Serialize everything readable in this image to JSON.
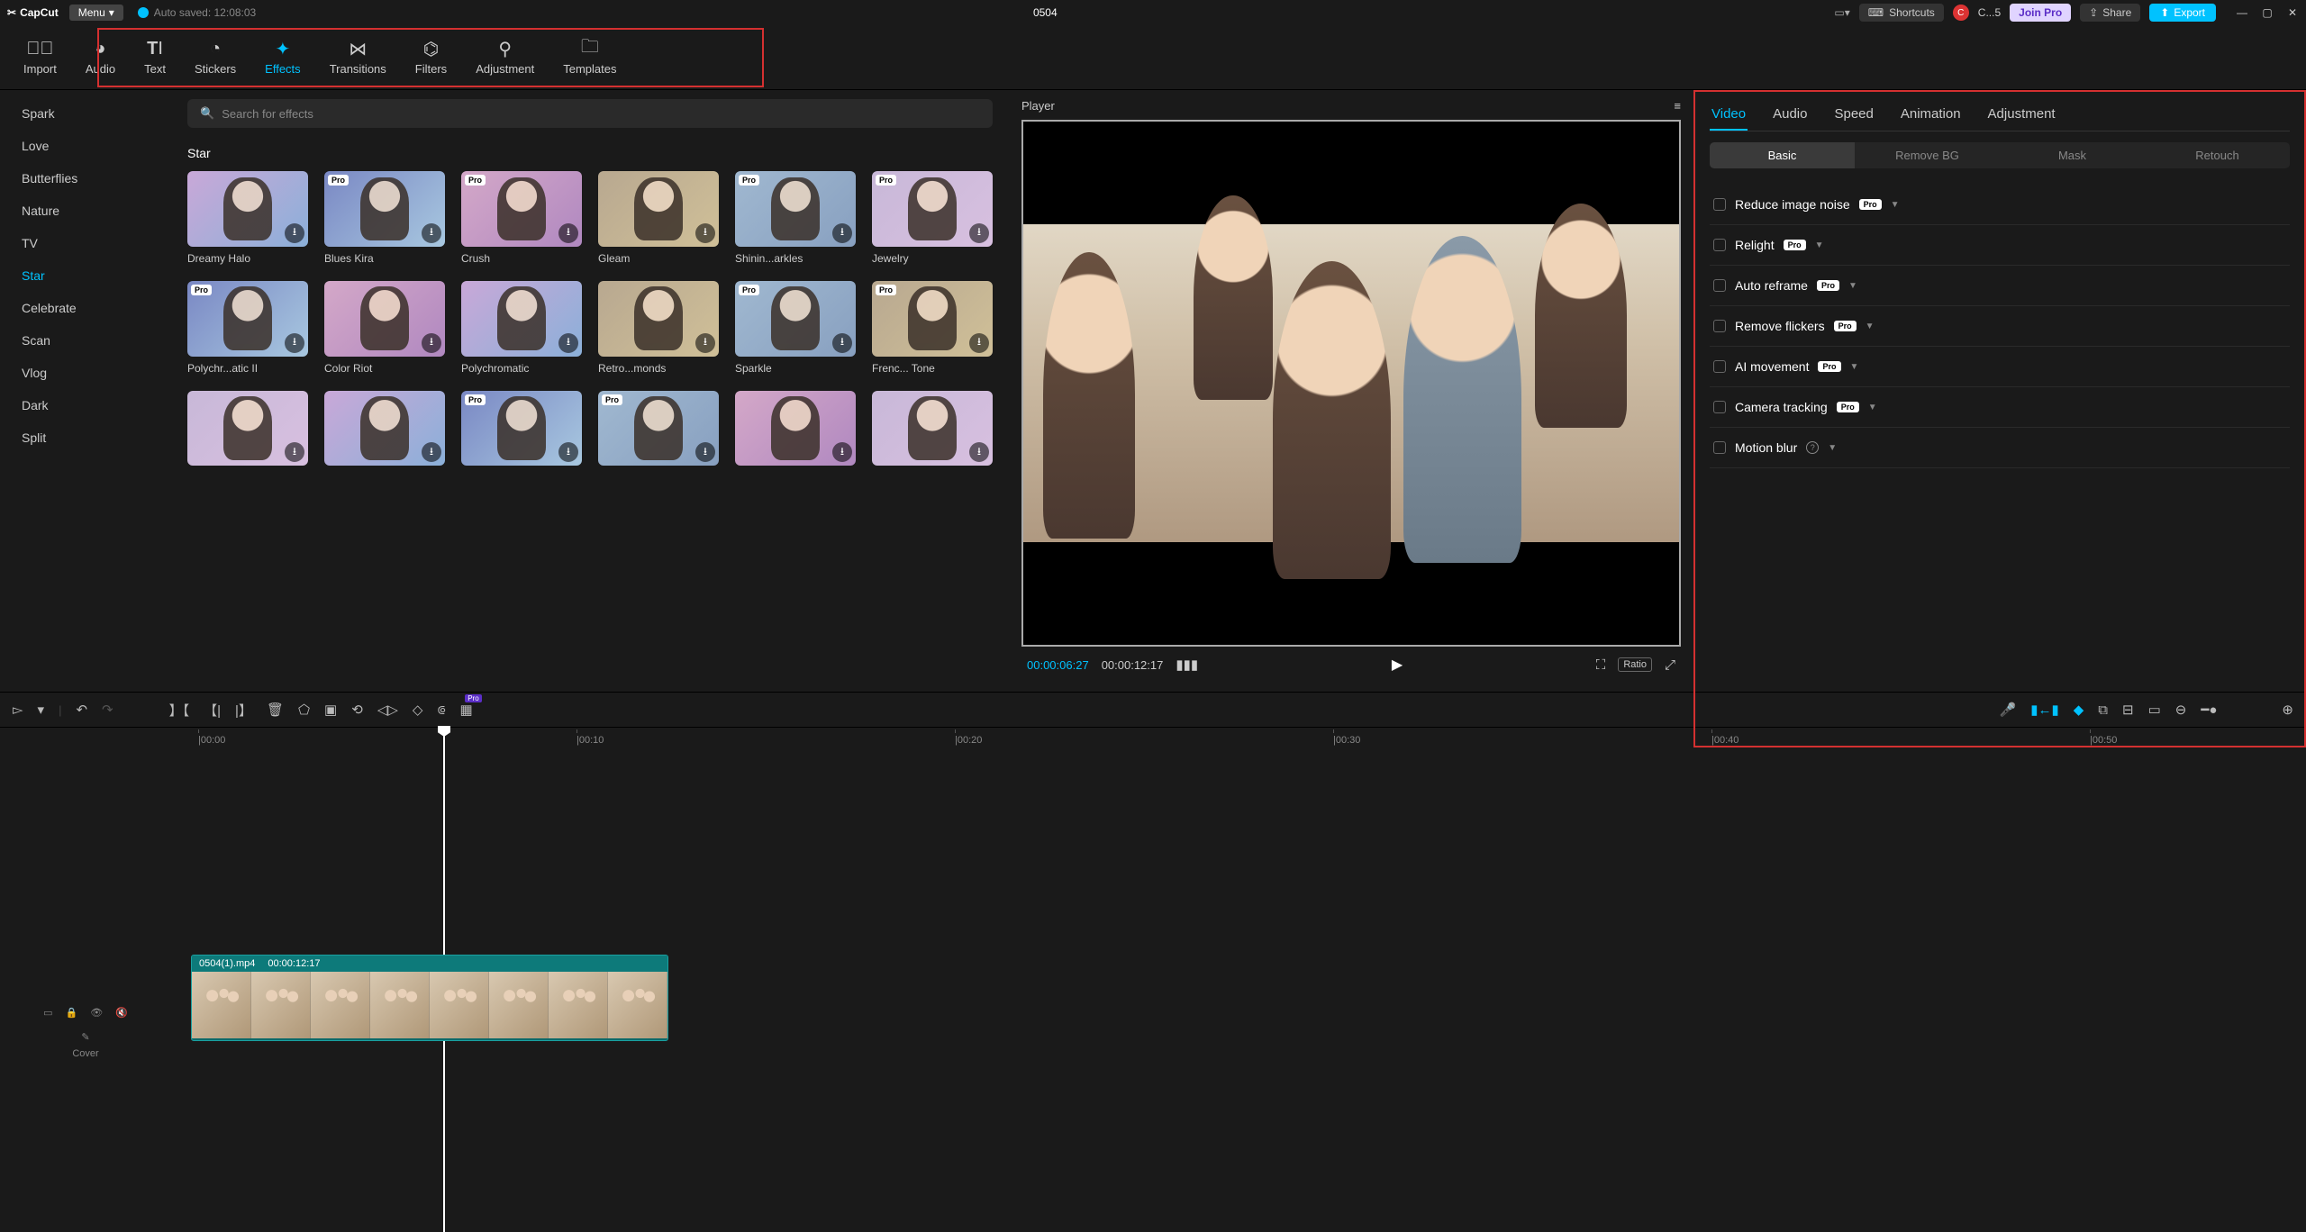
{
  "titlebar": {
    "app_name": "CapCut",
    "menu_label": "Menu",
    "autosave_label": "Auto saved: 12:08:03",
    "project_title": "0504",
    "shortcuts_label": "Shortcuts",
    "user_initial": "C",
    "user_name": "C...5",
    "join_pro_label": "Join Pro",
    "share_label": "Share",
    "export_label": "Export"
  },
  "top_tabs": [
    {
      "label": "Import"
    },
    {
      "label": "Audio"
    },
    {
      "label": "Text"
    },
    {
      "label": "Stickers"
    },
    {
      "label": "Effects"
    },
    {
      "label": "Transitions"
    },
    {
      "label": "Filters"
    },
    {
      "label": "Adjustment"
    },
    {
      "label": "Templates"
    }
  ],
  "categories": [
    "Spark",
    "Love",
    "Butterflies",
    "Nature",
    "TV",
    "Star",
    "Celebrate",
    "Scan",
    "Vlog",
    "Dark",
    "Split"
  ],
  "active_category": "Star",
  "search_placeholder": "Search for effects",
  "section_title": "Star",
  "effects": [
    {
      "name": "Dreamy Halo",
      "pro": false,
      "c": "a"
    },
    {
      "name": "Blues Kira",
      "pro": true,
      "c": "b"
    },
    {
      "name": "Crush",
      "pro": true,
      "c": "c"
    },
    {
      "name": "Gleam",
      "pro": false,
      "c": "d"
    },
    {
      "name": "Shinin...arkles",
      "pro": true,
      "c": "e"
    },
    {
      "name": "Jewelry",
      "pro": true,
      "c": "f"
    },
    {
      "name": "Polychr...atic II",
      "pro": true,
      "c": "b"
    },
    {
      "name": "Color Riot",
      "pro": false,
      "c": "c"
    },
    {
      "name": "Polychromatic",
      "pro": false,
      "c": "a"
    },
    {
      "name": "Retro...monds",
      "pro": false,
      "c": "d"
    },
    {
      "name": "Sparkle",
      "pro": true,
      "c": "e"
    },
    {
      "name": "Frenc... Tone",
      "pro": true,
      "c": "d"
    },
    {
      "name": "",
      "pro": false,
      "c": "f"
    },
    {
      "name": "",
      "pro": false,
      "c": "a"
    },
    {
      "name": "",
      "pro": true,
      "c": "b"
    },
    {
      "name": "",
      "pro": true,
      "c": "e"
    },
    {
      "name": "",
      "pro": false,
      "c": "c"
    },
    {
      "name": "",
      "pro": false,
      "c": "f"
    }
  ],
  "player": {
    "title": "Player",
    "current_time": "00:00:06:27",
    "duration": "00:00:12:17",
    "ratio_label": "Ratio"
  },
  "inspector": {
    "tabs": [
      "Video",
      "Audio",
      "Speed",
      "Animation",
      "Adjustment"
    ],
    "active_tab": "Video",
    "subtabs": [
      "Basic",
      "Remove BG",
      "Mask",
      "Retouch"
    ],
    "active_sub": "Basic",
    "rows": [
      {
        "label": "Reduce image noise",
        "pro": true,
        "info": false
      },
      {
        "label": "Relight",
        "pro": true,
        "info": false
      },
      {
        "label": "Auto reframe",
        "pro": true,
        "info": false
      },
      {
        "label": "Remove flickers",
        "pro": true,
        "info": false
      },
      {
        "label": "AI movement",
        "pro": true,
        "info": false
      },
      {
        "label": "Camera tracking",
        "pro": true,
        "info": false
      },
      {
        "label": "Motion blur",
        "pro": false,
        "info": true
      }
    ]
  },
  "timeline": {
    "cover_label": "Cover",
    "ticks": [
      "00:00",
      "00:10",
      "00:20",
      "00:30",
      "00:40",
      "00:50"
    ],
    "clip_name": "0504(1).mp4",
    "clip_duration": "00:00:12:17"
  }
}
